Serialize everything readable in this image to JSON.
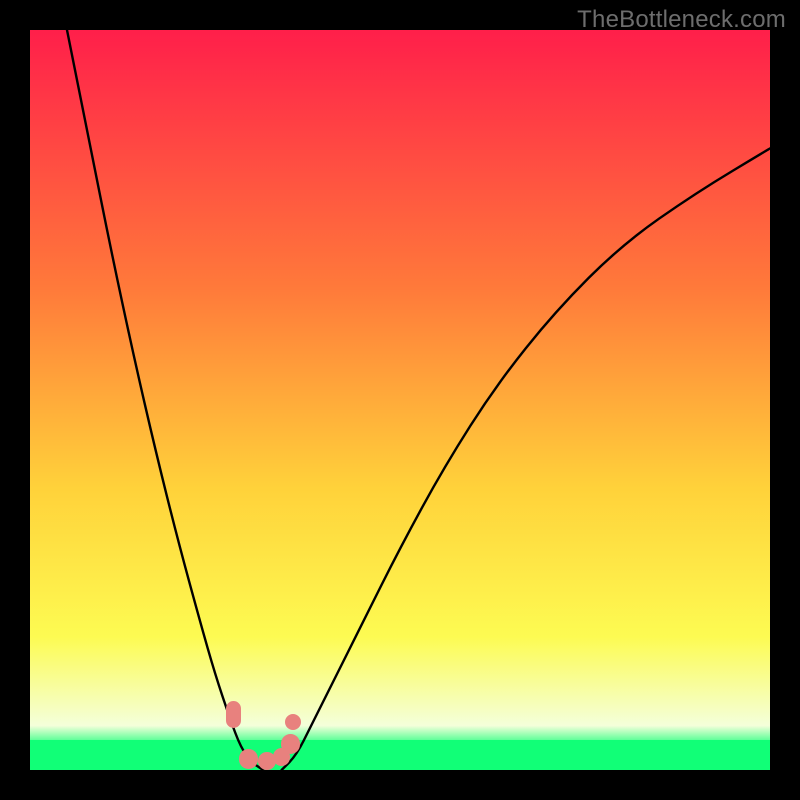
{
  "watermark": "TheBottleneck.com",
  "colors": {
    "black": "#000000",
    "marker": "#e8817e",
    "curve": "#000000",
    "watermark": "#6d6d6d",
    "gradient_top": "#ff1f4a",
    "gradient_mid1": "#ff7a3a",
    "gradient_mid2": "#ffd23a",
    "gradient_mid3": "#fdfb52",
    "gradient_pale": "#f4ffda",
    "green": "#11ff77"
  },
  "chart_data": {
    "type": "line",
    "title": "",
    "xlabel": "",
    "ylabel": "",
    "xlim": [
      0,
      100
    ],
    "ylim": [
      0,
      100
    ],
    "series": [
      {
        "name": "left-branch",
        "x": [
          5,
          8,
          11,
          14,
          17,
          20,
          23,
          25,
          27,
          28.5,
          30,
          31.5
        ],
        "y": [
          100,
          85,
          70,
          56,
          43,
          31,
          20,
          13,
          7,
          3,
          1,
          0
        ]
      },
      {
        "name": "right-branch",
        "x": [
          34,
          36,
          38,
          41,
          45,
          50,
          56,
          63,
          71,
          80,
          90,
          100
        ],
        "y": [
          0,
          2,
          6,
          12,
          20,
          30,
          41,
          52,
          62,
          71,
          78,
          84
        ]
      }
    ],
    "green_band_y": [
      0,
      4
    ],
    "markers": [
      {
        "name": "left-pill-marker",
        "x": 27.5,
        "y": 7.5,
        "r": 1.4,
        "shape": "pill"
      },
      {
        "name": "notch-upper-marker",
        "x": 35.5,
        "y": 6.5,
        "r": 1.1,
        "shape": "dot"
      },
      {
        "name": "notch-lower-marker",
        "x": 35.2,
        "y": 3.5,
        "r": 1.3,
        "shape": "dot"
      },
      {
        "name": "bottom-left-marker",
        "x": 29.5,
        "y": 1.5,
        "r": 1.3,
        "shape": "dot"
      },
      {
        "name": "bottom-mid-marker",
        "x": 32.0,
        "y": 1.2,
        "r": 1.2,
        "shape": "dot"
      },
      {
        "name": "bottom-right-marker",
        "x": 34.0,
        "y": 1.8,
        "r": 1.2,
        "shape": "dot"
      }
    ]
  }
}
